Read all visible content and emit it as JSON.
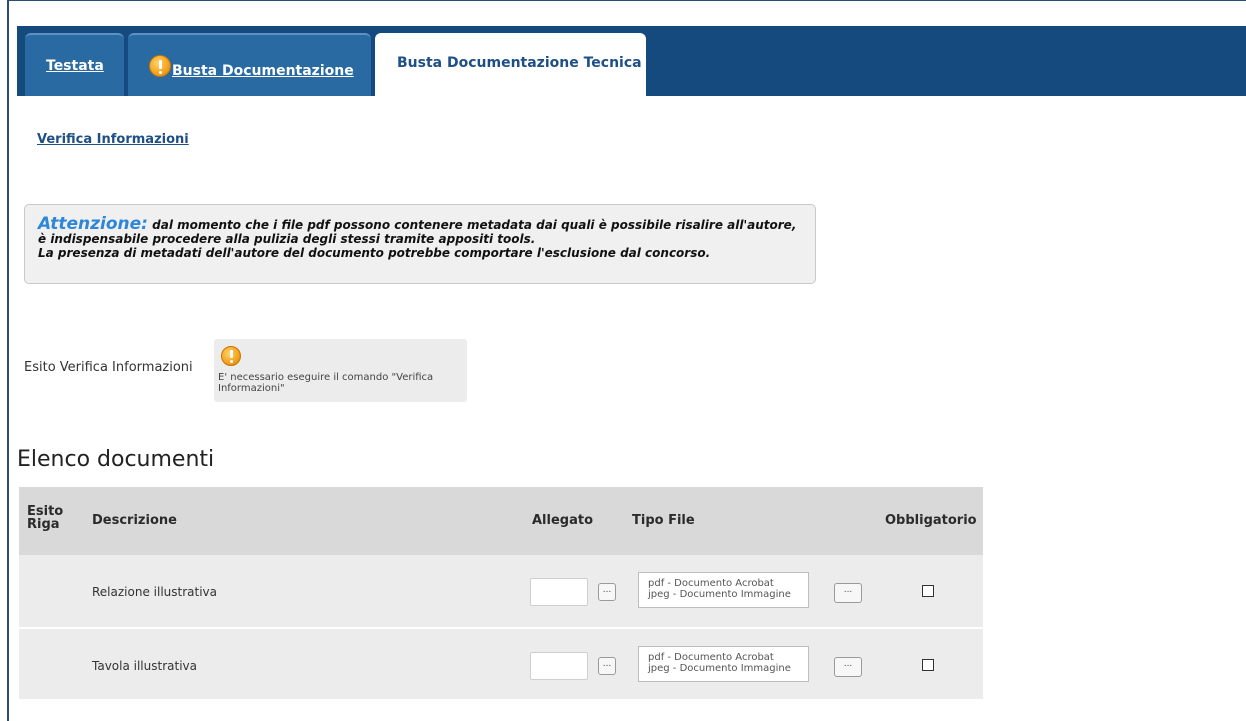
{
  "tabs": [
    {
      "label": "Testata"
    },
    {
      "label": "Busta Documentazione"
    },
    {
      "label": "Busta Documentazione Tecnica"
    }
  ],
  "verify_link": "Verifica Informazioni",
  "notice": {
    "attention": "Attenzione:",
    "line1": " dal momento che i file pdf possono contenere metadata dai quali è possibile risalire all'autore,",
    "line2": "è indispensabile procedere alla pulizia degli stessi tramite appositi tools.",
    "line3": "La presenza di metadati dell'autore del documento potrebbe comportare l'esclusione dal concorso."
  },
  "esito": {
    "label": "Esito Verifica Informazioni",
    "message": "E' necessario eseguire il comando \"Verifica Informazioni\""
  },
  "section_title": "Elenco documenti",
  "table": {
    "headers": {
      "esito": "Esito Riga",
      "descrizione": "Descrizione",
      "allegato": "Allegato",
      "tipo_file": "Tipo File",
      "obbligatorio": "Obbligatorio"
    },
    "rows": [
      {
        "descrizione": "Relazione illustrativa",
        "tipo_line1": "pdf - Documento Acrobat",
        "tipo_line2": "jpeg - Documento Immagine",
        "obbligatorio": false
      },
      {
        "descrizione": "Tavola illustrativa",
        "tipo_line1": "pdf - Documento Acrobat",
        "tipo_line2": "jpeg - Documento Immagine",
        "obbligatorio": false
      }
    ],
    "button_label": "..."
  }
}
